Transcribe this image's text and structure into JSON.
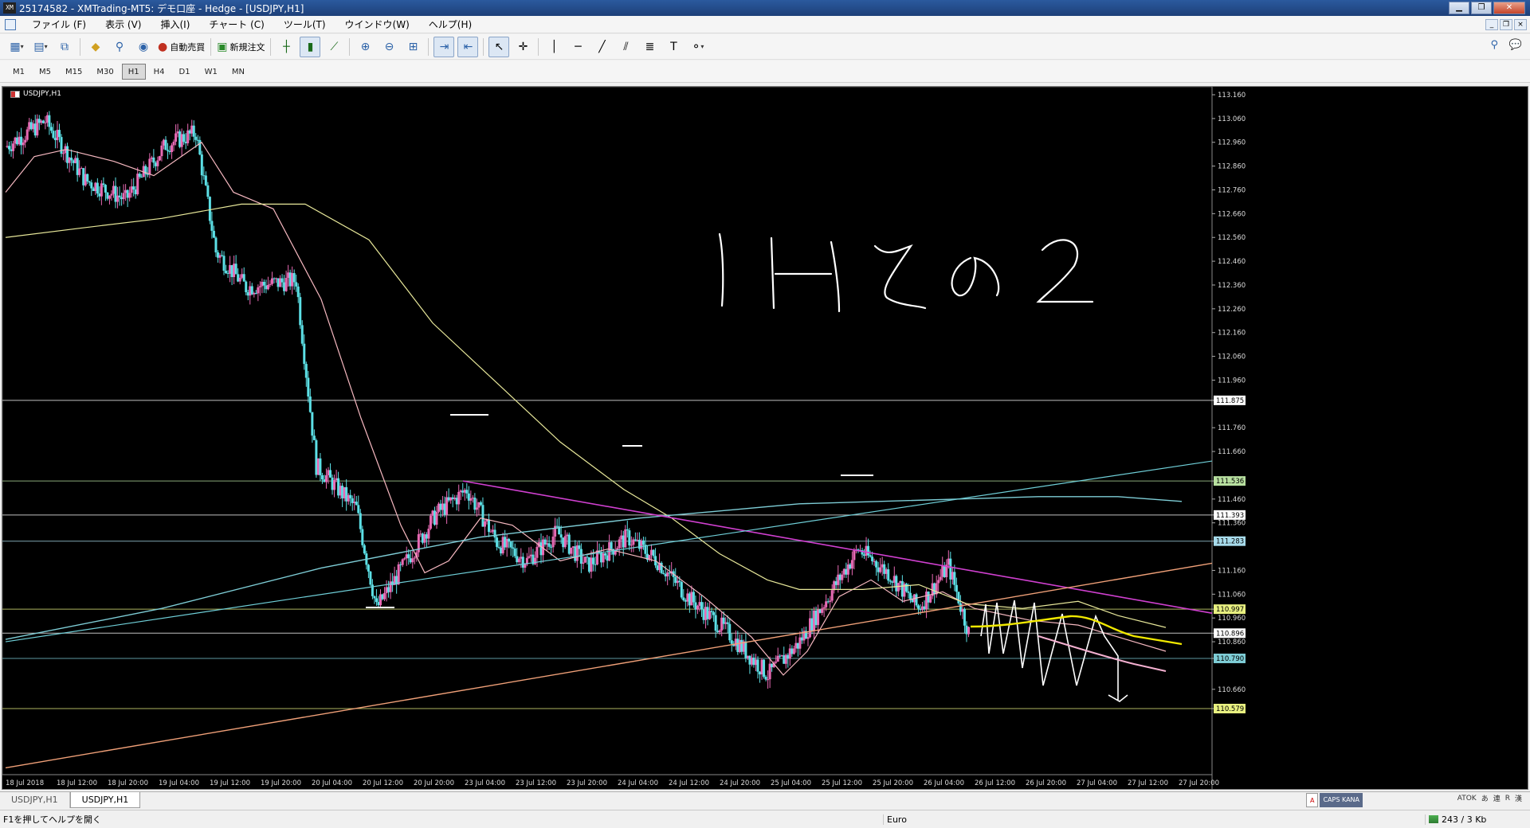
{
  "window": {
    "title": "25174582 - XMTrading-MT5: デモ口座 - Hedge - [USDJPY,H1]",
    "app_icon": "XM"
  },
  "menu": [
    "ファイル (F)",
    "表示 (V)",
    "挿入(I)",
    "チャート (C)",
    "ツール(T)",
    "ウインドウ(W)",
    "ヘルプ(H)"
  ],
  "toolbar": {
    "auto_trade_label": "自動売買",
    "new_order_label": "新規注文"
  },
  "timeframes": [
    "M1",
    "M5",
    "M15",
    "M30",
    "H1",
    "H4",
    "D1",
    "W1",
    "MN"
  ],
  "active_timeframe": "H1",
  "chart": {
    "symbol_title": "USDJPY,H1",
    "annotation_text": "1Hその2",
    "price_axis_labels": [
      "113.160",
      "113.060",
      "112.960",
      "112.860",
      "112.760",
      "112.660",
      "112.560",
      "112.460",
      "112.360",
      "112.260",
      "112.160",
      "112.060",
      "111.960",
      "111.875",
      "111.760",
      "111.660",
      "111.536",
      "111.460",
      "111.393",
      "111.360",
      "111.283",
      "111.160",
      "111.060",
      "110.997",
      "110.960",
      "110.896",
      "110.860",
      "110.790",
      "110.660",
      "110.579"
    ],
    "hline_labels": [
      {
        "value": "111.875",
        "color": "#ffffff"
      },
      {
        "value": "111.536",
        "color": "#b8e0a0"
      },
      {
        "value": "111.393",
        "color": "#ffffff"
      },
      {
        "value": "111.283",
        "color": "#a8dcec"
      },
      {
        "value": "110.997",
        "color": "#e8f080"
      },
      {
        "value": "110.896",
        "color": "#ffffff"
      },
      {
        "value": "110.790",
        "color": "#7ecdd6"
      },
      {
        "value": "110.579",
        "color": "#e8f080"
      }
    ],
    "time_labels": [
      "18 Jul 2018",
      "18 Jul 12:00",
      "18 Jul 20:00",
      "19 Jul 04:00",
      "19 Jul 12:00",
      "19 Jul 20:00",
      "20 Jul 04:00",
      "20 Jul 12:00",
      "20 Jul 20:00",
      "23 Jul 04:00",
      "23 Jul 12:00",
      "23 Jul 20:00",
      "24 Jul 04:00",
      "24 Jul 12:00",
      "24 Jul 20:00",
      "25 Jul 04:00",
      "25 Jul 12:00",
      "25 Jul 20:00",
      "26 Jul 04:00",
      "26 Jul 12:00",
      "26 Jul 20:00",
      "27 Jul 04:00",
      "27 Jul 12:00",
      "27 Jul 20:00"
    ],
    "colors": {
      "bull": "#e86ab4",
      "bear": "#5ce0e6",
      "ma_fast": "#f6b8c0",
      "ma_slow": "#e8e89a",
      "ma_long": "#7ecdd6",
      "trend_down": "#d040d0",
      "trend_up": "#f0a078"
    }
  },
  "tabs": [
    "USDJPY,H1",
    "USDJPY,H1"
  ],
  "active_tab": 1,
  "tray": [
    "ATOK",
    "あ",
    "連",
    "R",
    "漢"
  ],
  "status": {
    "help": "F1を押してヘルプを開く",
    "profile": "Euro",
    "traffic": "243 / 3 Kb"
  }
}
